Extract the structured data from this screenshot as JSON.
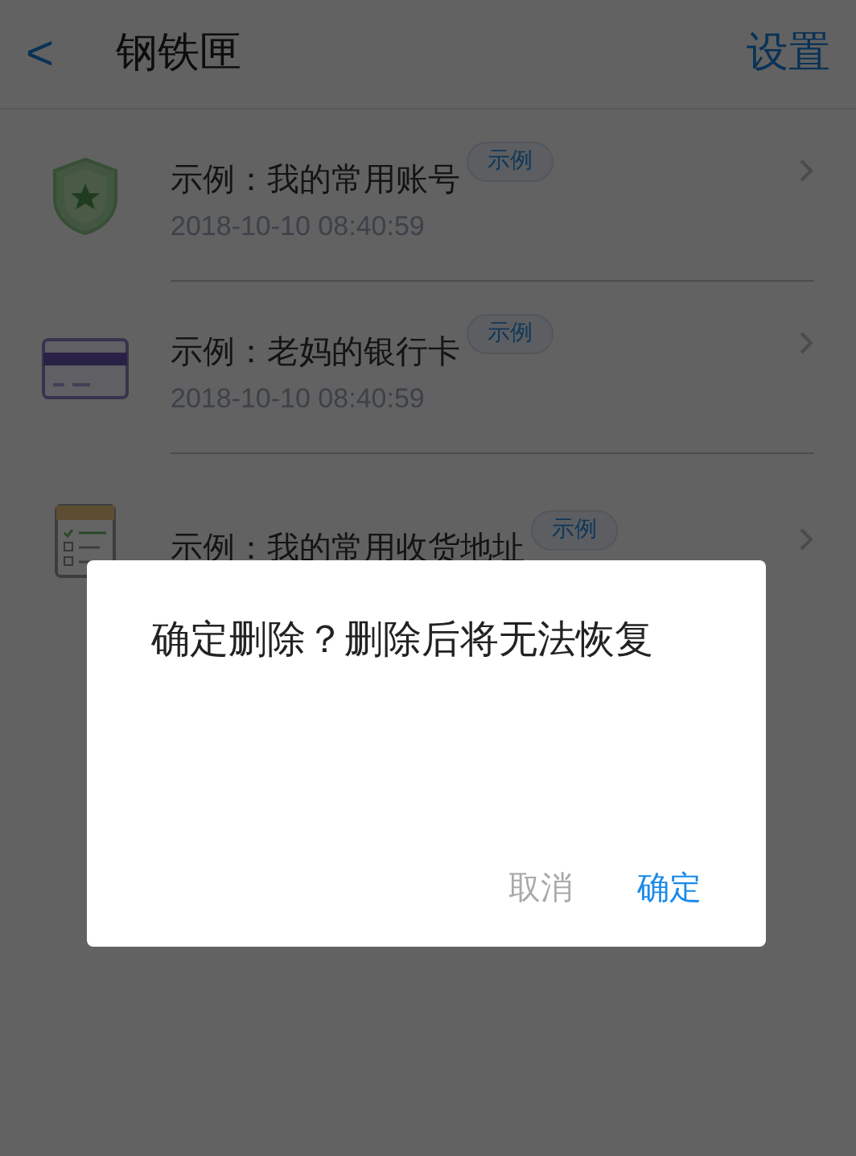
{
  "header": {
    "back": "<",
    "title": "钢铁匣",
    "action": "设置"
  },
  "items": [
    {
      "kind": "shield",
      "title": "示例：我的常用账号",
      "tag": "示例",
      "time": "2018-10-10 08:40:59"
    },
    {
      "kind": "card",
      "title": "示例：老妈的银行卡",
      "tag": "示例",
      "time": "2018-10-10 08:40:59"
    },
    {
      "kind": "checklist",
      "title": "示例：我的常用收货地址",
      "tag": "示例"
    }
  ],
  "dialog": {
    "message": "确定删除？删除后将无法恢复",
    "buttons": [
      {
        "label": "取消",
        "kind": "cancel"
      },
      {
        "label": "确定",
        "kind": "confirm"
      }
    ]
  }
}
